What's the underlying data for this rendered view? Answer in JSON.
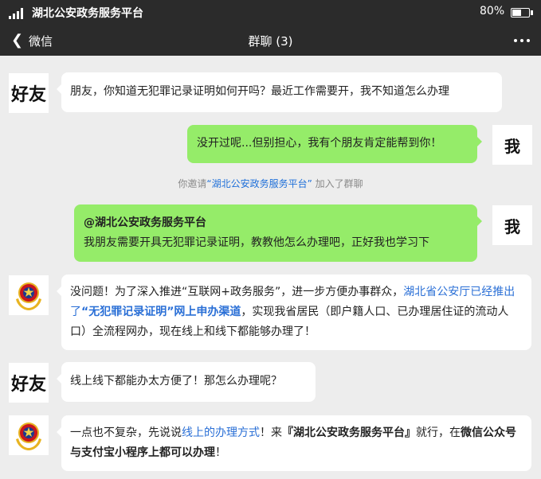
{
  "status_bar": {
    "carrier": "湖北公安政务服务平台",
    "battery": "80%"
  },
  "nav": {
    "back_label": "微信",
    "title": "群聊 (3)"
  },
  "avatars": {
    "friend": "好友",
    "me": "我"
  },
  "messages": {
    "m1": "朋友，你知道无犯罪记录证明如何开吗？最近工作需要开，我不知道怎么办理",
    "m2": "没开过呢...但别担心，我有个朋友肯定能帮到你！",
    "m4_mention": "@湖北公安政务服务平台",
    "m4_body": "我朋友需要开具无犯罪记录证明，教教他怎么办理吧，正好我也学习下",
    "m5_a": "没问题！为了深入推进“互联网+政务服务”，进一步方便办事群众，",
    "m5_b": "湖北省公安厅已经推出了",
    "m5_c": "“无犯罪记录证明”网上申办渠道",
    "m5_d": "，实现我省居民（即户籍人口、已办理居住证的流动人口）全流程网办，现在线上和线下都能够办理了！",
    "m6": "线上线下都能办太方便了！那怎么办理呢？",
    "m7_a": "一点也不复杂，先说说",
    "m7_b": "线上的办理方式",
    "m7_c": "！来",
    "m7_d": "『湖北公安政务服务平台』",
    "m7_e": "就行，在",
    "m7_f": "微信公众号与支付宝小程序上都可以办理",
    "m7_g": "！"
  },
  "system": {
    "prefix": "你邀请",
    "link": "“湖北公安政务服务平台”",
    "suffix": "加入了群聊"
  },
  "colors": {
    "bar": "#2b2b2b",
    "my_bubble": "#95ec69",
    "link_blue": "#2a6fd6",
    "emblem_red": "#c8161d",
    "emblem_gold": "#e8b422"
  },
  "icons": [
    "signal-icon",
    "battery-icon",
    "back-chevron-icon",
    "more-icon",
    "police-emblem-icon"
  ]
}
